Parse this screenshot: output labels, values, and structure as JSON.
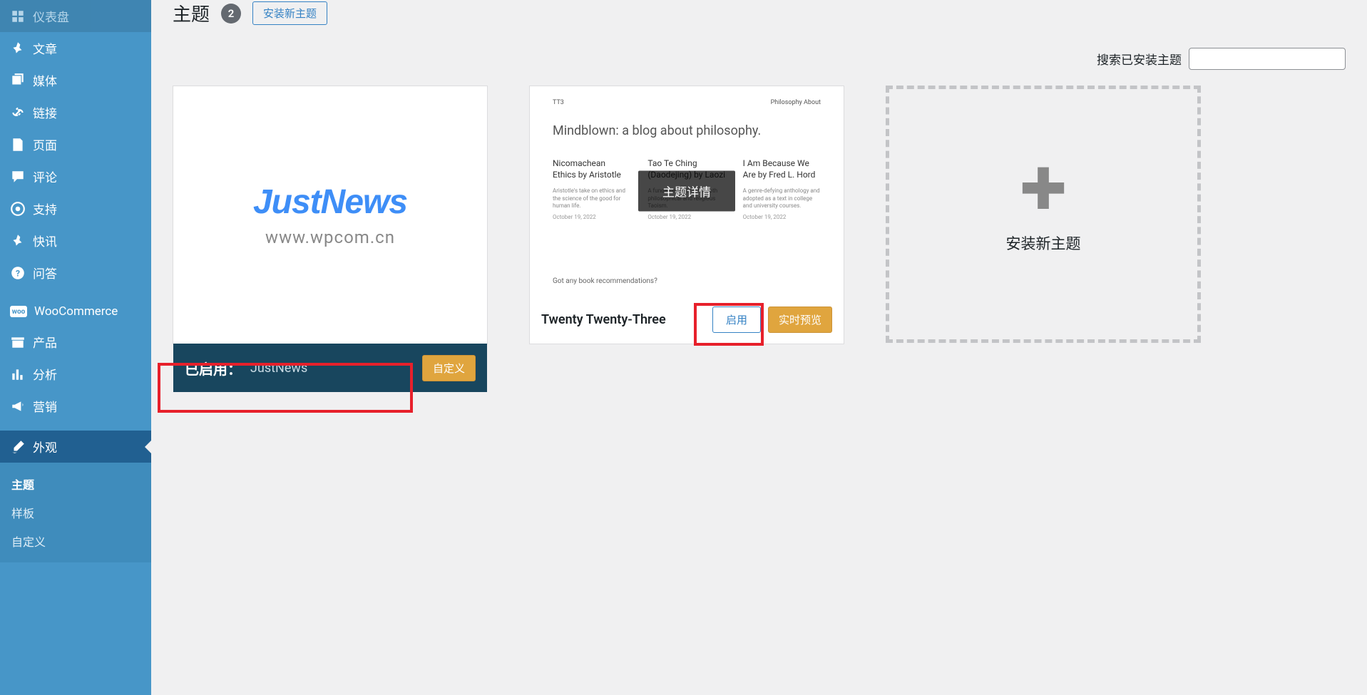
{
  "sidebar": {
    "items": [
      {
        "label": "仪表盘",
        "icon": "dashboard"
      },
      {
        "label": "文章",
        "icon": "pin"
      },
      {
        "label": "媒体",
        "icon": "media"
      },
      {
        "label": "链接",
        "icon": "link"
      },
      {
        "label": "页面",
        "icon": "page"
      },
      {
        "label": "评论",
        "icon": "comment"
      },
      {
        "label": "支持",
        "icon": "support"
      },
      {
        "label": "快讯",
        "icon": "pin"
      },
      {
        "label": "问答",
        "icon": "question"
      },
      {
        "label": "WooCommerce",
        "icon": "woo"
      },
      {
        "label": "产品",
        "icon": "archive"
      },
      {
        "label": "分析",
        "icon": "chart"
      },
      {
        "label": "营销",
        "icon": "megaphone"
      },
      {
        "label": "外观",
        "icon": "brush"
      }
    ],
    "submenu": [
      {
        "label": "主题"
      },
      {
        "label": "样板"
      },
      {
        "label": "自定义"
      }
    ]
  },
  "header": {
    "title": "主题",
    "count": "2",
    "install_btn": "安装新主题"
  },
  "search": {
    "label": "搜索已安装主题",
    "placeholder": ""
  },
  "themes": {
    "active": {
      "active_label": "已启用：",
      "name": "JustNews",
      "customize_btn": "自定义",
      "shot_title": "JustNews",
      "shot_url": "www.wpcom.cn"
    },
    "other": {
      "name": "Twenty Twenty-Three",
      "details_btn": "主题详情",
      "activate_btn": "启用",
      "preview_btn": "实时预览",
      "shot": {
        "brand": "TT3",
        "nav": "Philosophy   About",
        "headline": "Mindblown: a blog about philosophy.",
        "col1_title": "Nicomachean Ethics by Aristotle",
        "col2_title": "Tao Te Ching (Daodejing) by Laozi",
        "col3_title": "I Am Because We Are by Fred L. Hord",
        "col1_desc": "Aristotle's take on ethics and the science of the good for human life.",
        "col2_desc": "A fundamental text for both philosophical and religious Taoism.",
        "col3_desc": "A genre-defying anthology and adopted as a text in college and university courses.",
        "date": "October 19, 2022",
        "footer": "Got any book recommendations?"
      }
    },
    "add": {
      "label": "安装新主题"
    }
  }
}
